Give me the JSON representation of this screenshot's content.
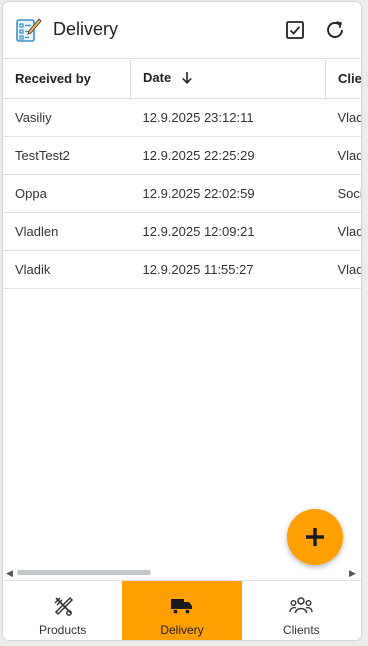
{
  "header": {
    "title": "Delivery",
    "icons": {
      "app": "checklist-pencil-icon",
      "select": "checkbox-icon",
      "refresh": "refresh-icon"
    }
  },
  "table": {
    "columns": [
      {
        "label": "Received by"
      },
      {
        "label": "Date",
        "sort": "descending"
      },
      {
        "label": "Client"
      }
    ],
    "rows": [
      {
        "received_by": "Vasiliy",
        "date": "12.9.2025 23:12:11",
        "client": "Vladlen"
      },
      {
        "received_by": "TestTest2",
        "date": "12.9.2025 22:25:29",
        "client": "Vladlen"
      },
      {
        "received_by": "Oppa",
        "date": "12.9.2025 22:02:59",
        "client": "Social"
      },
      {
        "received_by": "Vladlen",
        "date": "12.9.2025 12:09:21",
        "client": "Vladlen"
      },
      {
        "received_by": "Vladik",
        "date": "12.9.2025 11:55:27",
        "client": "Vladlen"
      }
    ]
  },
  "fab": {
    "icon": "plus-icon"
  },
  "bottom_nav": [
    {
      "label": "Products",
      "icon": "utensils-icon",
      "active": false
    },
    {
      "label": "Delivery",
      "icon": "truck-icon",
      "active": true
    },
    {
      "label": "Clients",
      "icon": "users-icon",
      "active": false
    }
  ],
  "colors": {
    "accent": "#ff9f00",
    "divider": "#e0e0e0",
    "scroll_thumb": "#c3c7cc"
  }
}
